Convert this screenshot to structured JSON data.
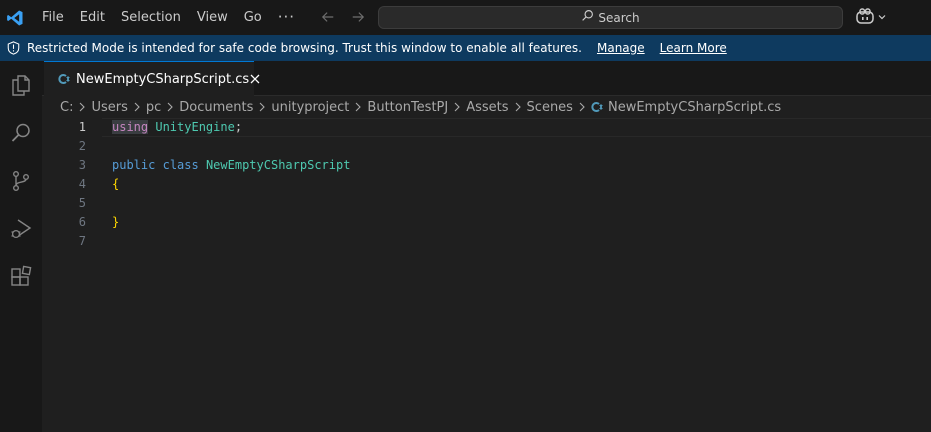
{
  "menu": [
    "File",
    "Edit",
    "Selection",
    "View",
    "Go"
  ],
  "menu_more": "···",
  "search": {
    "label": "Search"
  },
  "banner": {
    "message": "Restricted Mode is intended for safe code browsing. Trust this window to enable all features.",
    "manage": "Manage",
    "learn_more": "Learn More"
  },
  "tab": {
    "label": "NewEmptyCSharpScript.cs"
  },
  "breadcrumb": [
    "C:",
    "Users",
    "pc",
    "Documents",
    "unityproject",
    "ButtonTestPJ",
    "Assets",
    "Scenes",
    "NewEmptyCSharpScript.cs"
  ],
  "editor": {
    "line_numbers": [
      "1",
      "2",
      "3",
      "4",
      "5",
      "6",
      "7"
    ],
    "line1": {
      "kw": "using",
      "ns": "UnityEngine",
      "semi": ";"
    },
    "line3": {
      "mod": "public",
      "kw": "class",
      "name": "NewEmptyCSharpScript"
    },
    "line4": {
      "brace": "{"
    },
    "line6": {
      "brace": "}"
    }
  },
  "colors": {
    "accent": "#0078d4",
    "banner": "#0e3a5f",
    "keyword": "#569cd6",
    "type": "#4ec9b0",
    "brace": "#ffd700",
    "using": "#c586c0"
  }
}
